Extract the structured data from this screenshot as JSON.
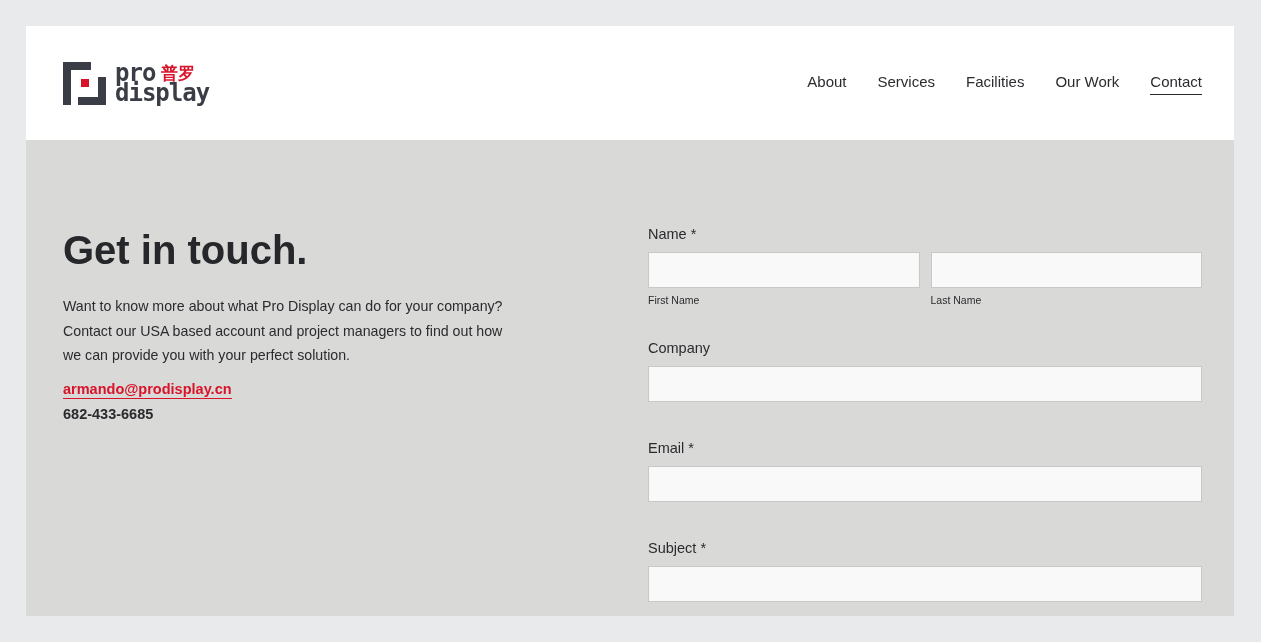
{
  "logo": {
    "line_1": "pro",
    "line_2": "display",
    "chinese": "普罗"
  },
  "nav": [
    {
      "label": "About",
      "selected": false
    },
    {
      "label": "Services",
      "selected": false
    },
    {
      "label": "Facilities",
      "selected": false
    },
    {
      "label": "Our Work",
      "selected": false
    },
    {
      "label": "Contact",
      "selected": true
    }
  ],
  "intro": {
    "heading": "Get in touch.",
    "text": "Want to know more about what Pro Display can do for your company? Contact our USA based account and project managers to find out how we can provide you with your perfect solution.",
    "email": "armando@prodisplay.cn",
    "phone": "682-433-6685"
  },
  "form": [
    {
      "kind": "split",
      "label": "Name *",
      "parts": [
        "First Name",
        "Last Name"
      ]
    },
    {
      "kind": "single",
      "label": "Company"
    },
    {
      "kind": "single",
      "label": "Email *"
    },
    {
      "kind": "single",
      "label": "Subject *"
    }
  ]
}
